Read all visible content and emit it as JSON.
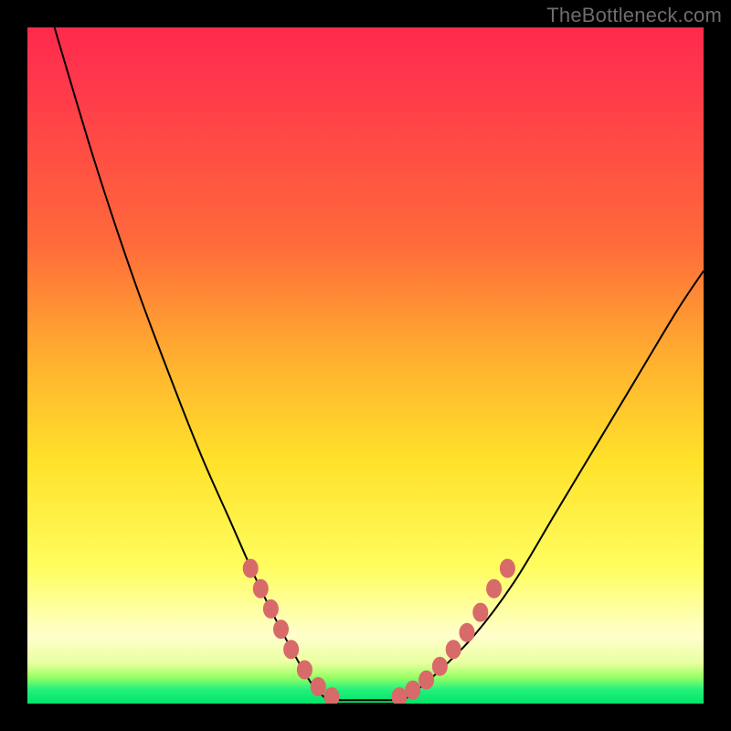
{
  "watermark": "TheBottleneck.com",
  "colors": {
    "frame": "#000000",
    "gradient_top": "#ff2a4d",
    "gradient_mid": "#ffe12a",
    "gradient_bottom": "#00e56a",
    "curve": "#000000",
    "bead": "#d86a6a"
  },
  "chart_data": {
    "type": "line",
    "title": "",
    "xlabel": "",
    "ylabel": "",
    "xlim": [
      0,
      100
    ],
    "ylim": [
      0,
      100
    ],
    "grid": false,
    "legend": false,
    "series": [
      {
        "name": "left-curve",
        "x": [
          4,
          10,
          16,
          22,
          26,
          30,
          34,
          38,
          42,
          45
        ],
        "y": [
          100,
          80,
          62,
          46,
          36,
          27,
          18,
          10,
          3,
          0
        ]
      },
      {
        "name": "floor",
        "x": [
          45,
          55
        ],
        "y": [
          0,
          0
        ]
      },
      {
        "name": "right-curve",
        "x": [
          55,
          60,
          66,
          72,
          78,
          84,
          90,
          96,
          100
        ],
        "y": [
          0,
          4,
          10,
          18,
          28,
          38,
          48,
          58,
          64
        ]
      }
    ],
    "beads_left": [
      {
        "x": 33,
        "y": 20
      },
      {
        "x": 34.5,
        "y": 17
      },
      {
        "x": 36,
        "y": 14
      },
      {
        "x": 37.5,
        "y": 11
      },
      {
        "x": 39,
        "y": 8
      },
      {
        "x": 41,
        "y": 5
      },
      {
        "x": 43,
        "y": 2.5
      },
      {
        "x": 45,
        "y": 1
      }
    ],
    "beads_right": [
      {
        "x": 55,
        "y": 1
      },
      {
        "x": 57,
        "y": 2
      },
      {
        "x": 59,
        "y": 3.5
      },
      {
        "x": 61,
        "y": 5.5
      },
      {
        "x": 63,
        "y": 8
      },
      {
        "x": 65,
        "y": 10.5
      },
      {
        "x": 67,
        "y": 13.5
      },
      {
        "x": 69,
        "y": 17
      },
      {
        "x": 71,
        "y": 20
      }
    ],
    "floor_segment": {
      "x1": 45,
      "x2": 55,
      "y": 0.5
    }
  }
}
